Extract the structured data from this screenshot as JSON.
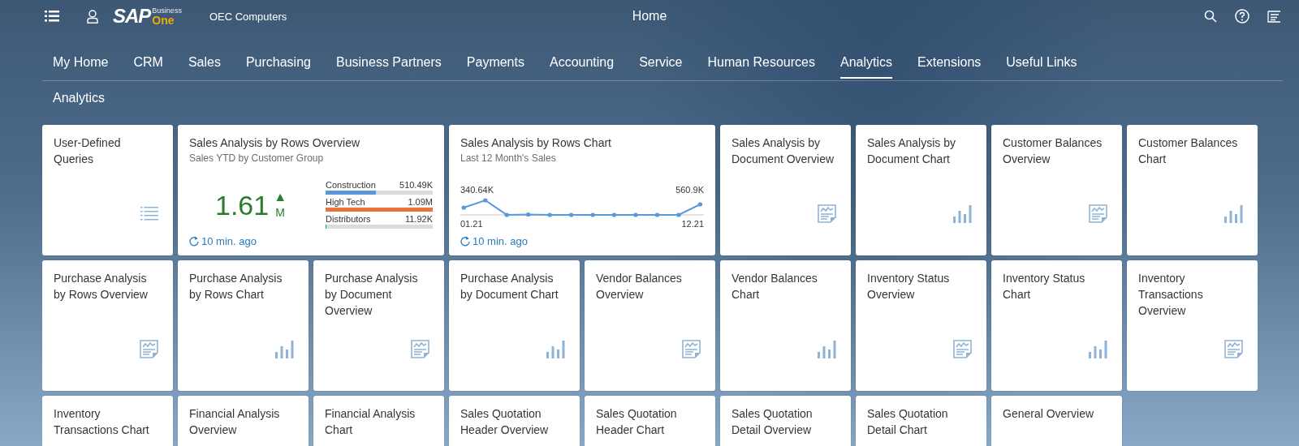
{
  "header": {
    "logo": {
      "brand": "SAP",
      "line_1": "Business",
      "line_2": "One"
    },
    "company": "OEC Computers",
    "title": "Home"
  },
  "nav": [
    {
      "label": "My Home",
      "selected": false
    },
    {
      "label": "CRM",
      "selected": false
    },
    {
      "label": "Sales",
      "selected": false
    },
    {
      "label": "Purchasing",
      "selected": false
    },
    {
      "label": "Business Partners",
      "selected": false
    },
    {
      "label": "Payments",
      "selected": false
    },
    {
      "label": "Accounting",
      "selected": false
    },
    {
      "label": "Service",
      "selected": false
    },
    {
      "label": "Human Resources",
      "selected": false
    },
    {
      "label": "Analytics",
      "selected": true
    },
    {
      "label": "Extensions",
      "selected": false
    },
    {
      "label": "Useful Links",
      "selected": false
    }
  ],
  "section_title": "Analytics",
  "tiles": [
    {
      "kind": "list",
      "title": "User-Defined Queries"
    },
    {
      "kind": "kpi",
      "title": "Sales Analysis by Rows Overview",
      "subtitle": "Sales YTD by Customer Group",
      "value": "1.61",
      "unit": "M",
      "trend": "▲",
      "bars": [
        {
          "label": "Construction",
          "reading": "510.49K",
          "level": 0.47,
          "color": "#5899da"
        },
        {
          "label": "High Tech",
          "reading": "1.09M",
          "level": 1,
          "color": "#e8743b"
        },
        {
          "label": "Distributors",
          "reading": "11.92K",
          "level": 0.01,
          "color": "#19a979"
        }
      ],
      "refreshed": "10 min. ago"
    },
    {
      "kind": "line",
      "title": "Sales Analysis by Rows Chart",
      "subtitle": "Last 12 Month's Sales",
      "start_value": "340.64K",
      "end_value": "560.9K",
      "start_label": "01.21",
      "end_label": "12.21",
      "refreshed": "10 min. ago"
    },
    {
      "kind": "report",
      "title": "Sales Analysis by Document Overview"
    },
    {
      "kind": "bars",
      "title": "Sales Analysis by Document Chart"
    },
    {
      "kind": "report",
      "title": "Customer Balances Overview"
    },
    {
      "kind": "bars",
      "title": "Customer Balances Chart"
    },
    {
      "kind": "report",
      "title": "Purchase Analysis by Rows Overview"
    },
    {
      "kind": "bars",
      "title": "Purchase Analysis by Rows Chart"
    },
    {
      "kind": "report",
      "title": "Purchase Analysis by Document Overview"
    },
    {
      "kind": "bars",
      "title": "Purchase Analysis by Document Chart"
    },
    {
      "kind": "report",
      "title": "Vendor Balances Overview"
    },
    {
      "kind": "bars",
      "title": "Vendor Balances Chart"
    },
    {
      "kind": "report",
      "title": "Inventory Status Overview"
    },
    {
      "kind": "bars",
      "title": "Inventory Status Chart"
    },
    {
      "kind": "report",
      "title": "Inventory Transactions Overview"
    },
    {
      "kind": "plain",
      "title": "Inventory Transactions Chart"
    },
    {
      "kind": "plain",
      "title": "Financial Analysis Overview"
    },
    {
      "kind": "plain",
      "title": "Financial Analysis Chart"
    },
    {
      "kind": "plain",
      "title": "Sales Quotation Header Overview"
    },
    {
      "kind": "plain",
      "title": "Sales Quotation Header Chart"
    },
    {
      "kind": "plain",
      "title": "Sales Quotation Detail Overview"
    },
    {
      "kind": "plain",
      "title": "Sales Quotation Detail Chart"
    },
    {
      "kind": "plain",
      "title": "General Overview"
    }
  ]
}
